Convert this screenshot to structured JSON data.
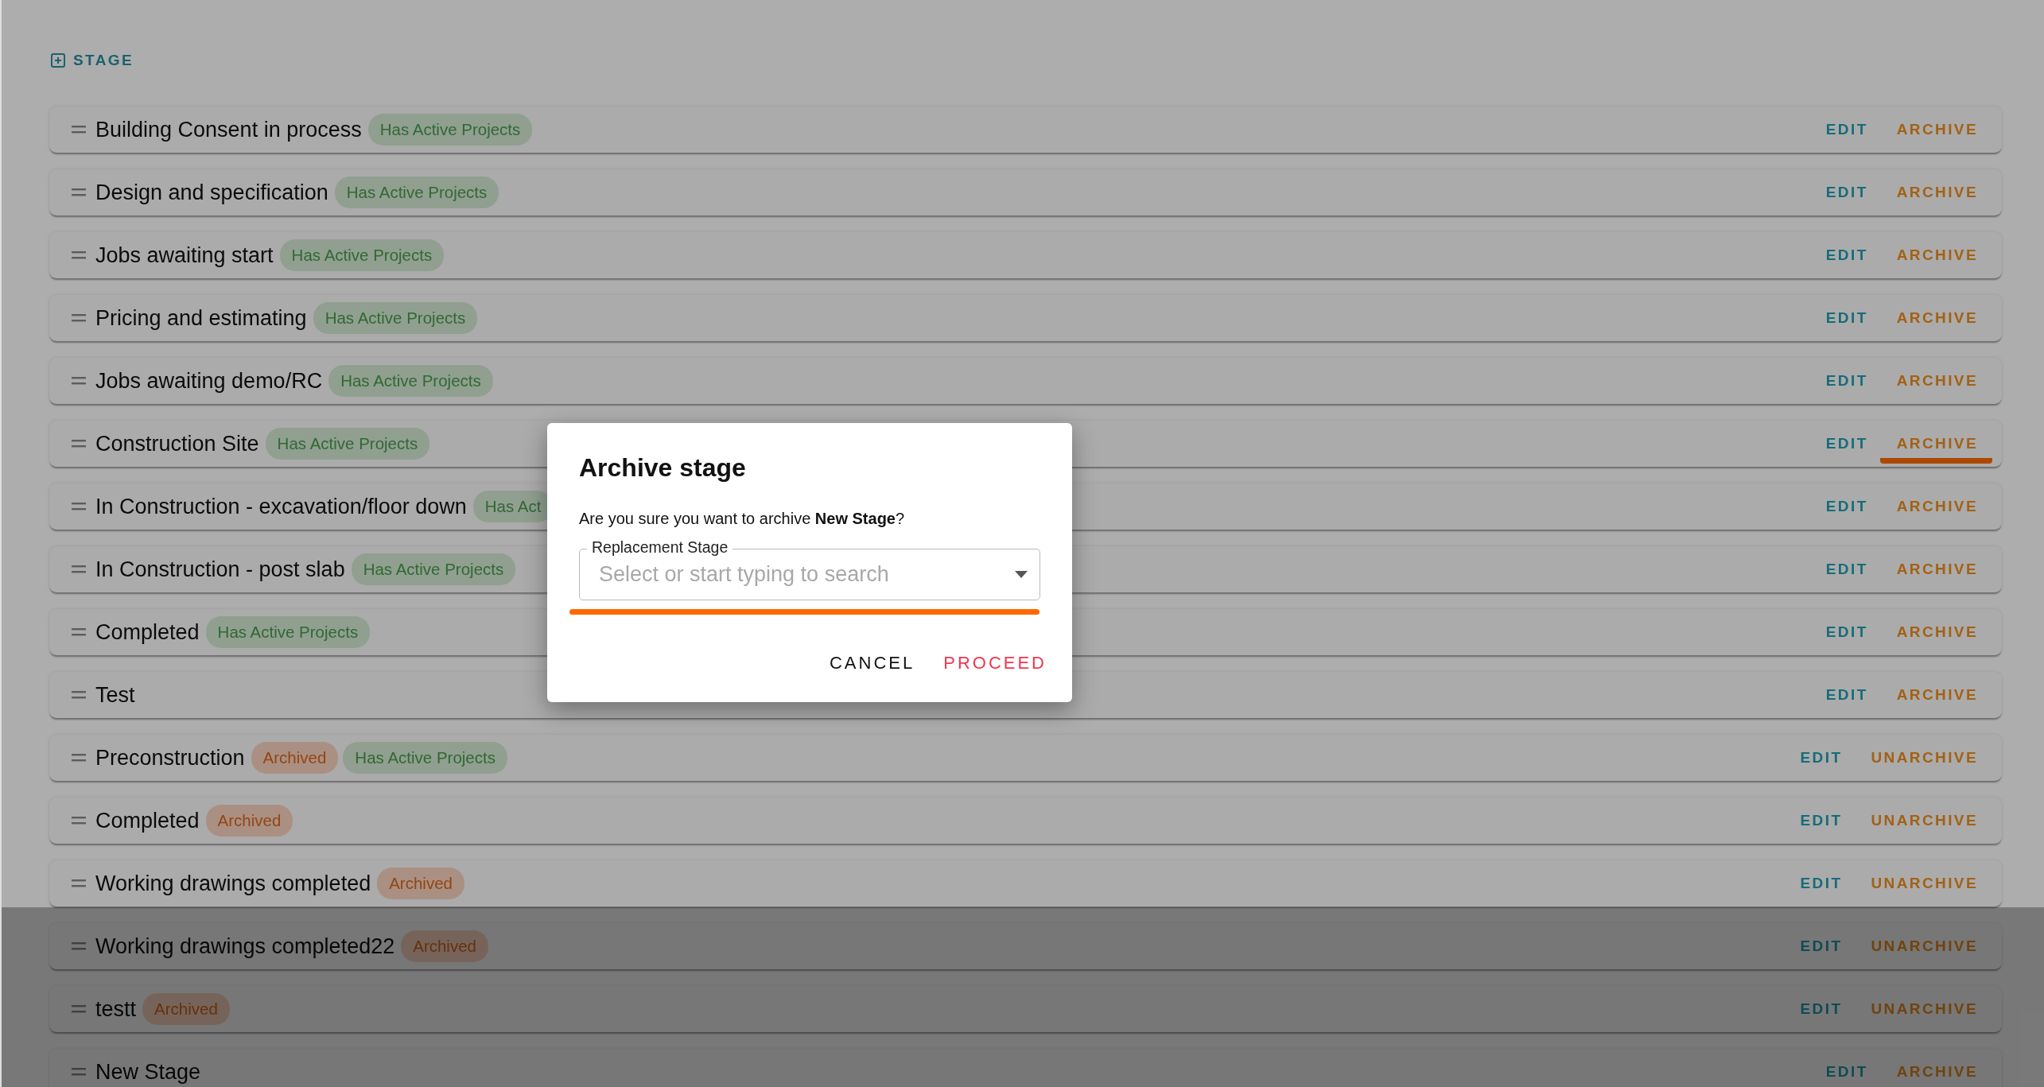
{
  "header": {
    "add_button": "STAGE"
  },
  "stages": [
    {
      "name": "Building Consent in process",
      "tags": [
        {
          "label": "Has Active Projects",
          "kind": "active"
        }
      ],
      "edit": "EDIT",
      "archive": {
        "label": "ARCHIVE",
        "underlined": false
      }
    },
    {
      "name": "Design and specification",
      "tags": [
        {
          "label": "Has Active Projects",
          "kind": "active"
        }
      ],
      "edit": "EDIT",
      "archive": {
        "label": "ARCHIVE",
        "underlined": false
      }
    },
    {
      "name": "Jobs awaiting start",
      "tags": [
        {
          "label": "Has Active Projects",
          "kind": "active"
        }
      ],
      "edit": "EDIT",
      "archive": {
        "label": "ARCHIVE",
        "underlined": false
      }
    },
    {
      "name": "Pricing and estimating",
      "tags": [
        {
          "label": "Has Active Projects",
          "kind": "active"
        }
      ],
      "edit": "EDIT",
      "archive": {
        "label": "ARCHIVE",
        "underlined": false
      }
    },
    {
      "name": "Jobs awaiting demo/RC",
      "tags": [
        {
          "label": "Has Active Projects",
          "kind": "active"
        }
      ],
      "edit": "EDIT",
      "archive": {
        "label": "ARCHIVE",
        "underlined": false
      }
    },
    {
      "name": "Construction Site",
      "tags": [
        {
          "label": "Has Active Projects",
          "kind": "active"
        }
      ],
      "edit": "EDIT",
      "archive": {
        "label": "ARCHIVE",
        "underlined": true
      }
    },
    {
      "name": "In Construction - excavation/floor down",
      "tags": [
        {
          "label": "Has Act",
          "kind": "active"
        }
      ],
      "edit": "EDIT",
      "archive": {
        "label": "ARCHIVE",
        "underlined": false
      }
    },
    {
      "name": "In Construction - post slab",
      "tags": [
        {
          "label": "Has Active Projects",
          "kind": "active"
        }
      ],
      "edit": "EDIT",
      "archive": {
        "label": "ARCHIVE",
        "underlined": false
      }
    },
    {
      "name": "Completed",
      "tags": [
        {
          "label": "Has Active Projects",
          "kind": "active"
        }
      ],
      "edit": "EDIT",
      "archive": {
        "label": "ARCHIVE",
        "underlined": false
      }
    },
    {
      "name": "Test",
      "edit": "EDIT",
      "archive": {
        "label": "ARCHIVE",
        "underlined": false
      }
    },
    {
      "name": "Preconstruction",
      "tags": [
        {
          "label": "Archived",
          "kind": "archived"
        },
        {
          "label": "Has Active Projects",
          "kind": "active"
        }
      ],
      "edit": "EDIT",
      "archive": {
        "label": "UNARCHIVE",
        "underlined": false
      }
    },
    {
      "name": "Completed",
      "tags": [
        {
          "label": "Archived",
          "kind": "archived"
        }
      ],
      "edit": "EDIT",
      "archive": {
        "label": "UNARCHIVE",
        "underlined": false
      }
    },
    {
      "name": "Working drawings completed",
      "tags": [
        {
          "label": "Archived",
          "kind": "archived"
        }
      ],
      "edit": "EDIT",
      "archive": {
        "label": "UNARCHIVE",
        "underlined": false
      }
    },
    {
      "name": "Working drawings completed22",
      "tags": [
        {
          "label": "Archived",
          "kind": "archived"
        }
      ],
      "edit": "EDIT",
      "archive": {
        "label": "UNARCHIVE",
        "underlined": false
      }
    },
    {
      "name": "testt",
      "tags": [
        {
          "label": "Archived",
          "kind": "archived"
        }
      ],
      "edit": "EDIT",
      "archive": {
        "label": "UNARCHIVE",
        "underlined": false
      }
    },
    {
      "name": "New Stage",
      "edit": "EDIT",
      "archive": {
        "label": "ARCHIVE",
        "underlined": false
      }
    }
  ],
  "dialog": {
    "title": "Archive stage",
    "message": "Are you sure you want to archive **New Stage**?",
    "field": {
      "label": "Replacement Stage",
      "placeholder": "Select or start typing to search",
      "underlined": true
    },
    "buttons": [
      {
        "label": "CANCEL",
        "kind": "cancel"
      },
      {
        "label": "PROCEED",
        "kind": "proceed"
      }
    ]
  }
}
